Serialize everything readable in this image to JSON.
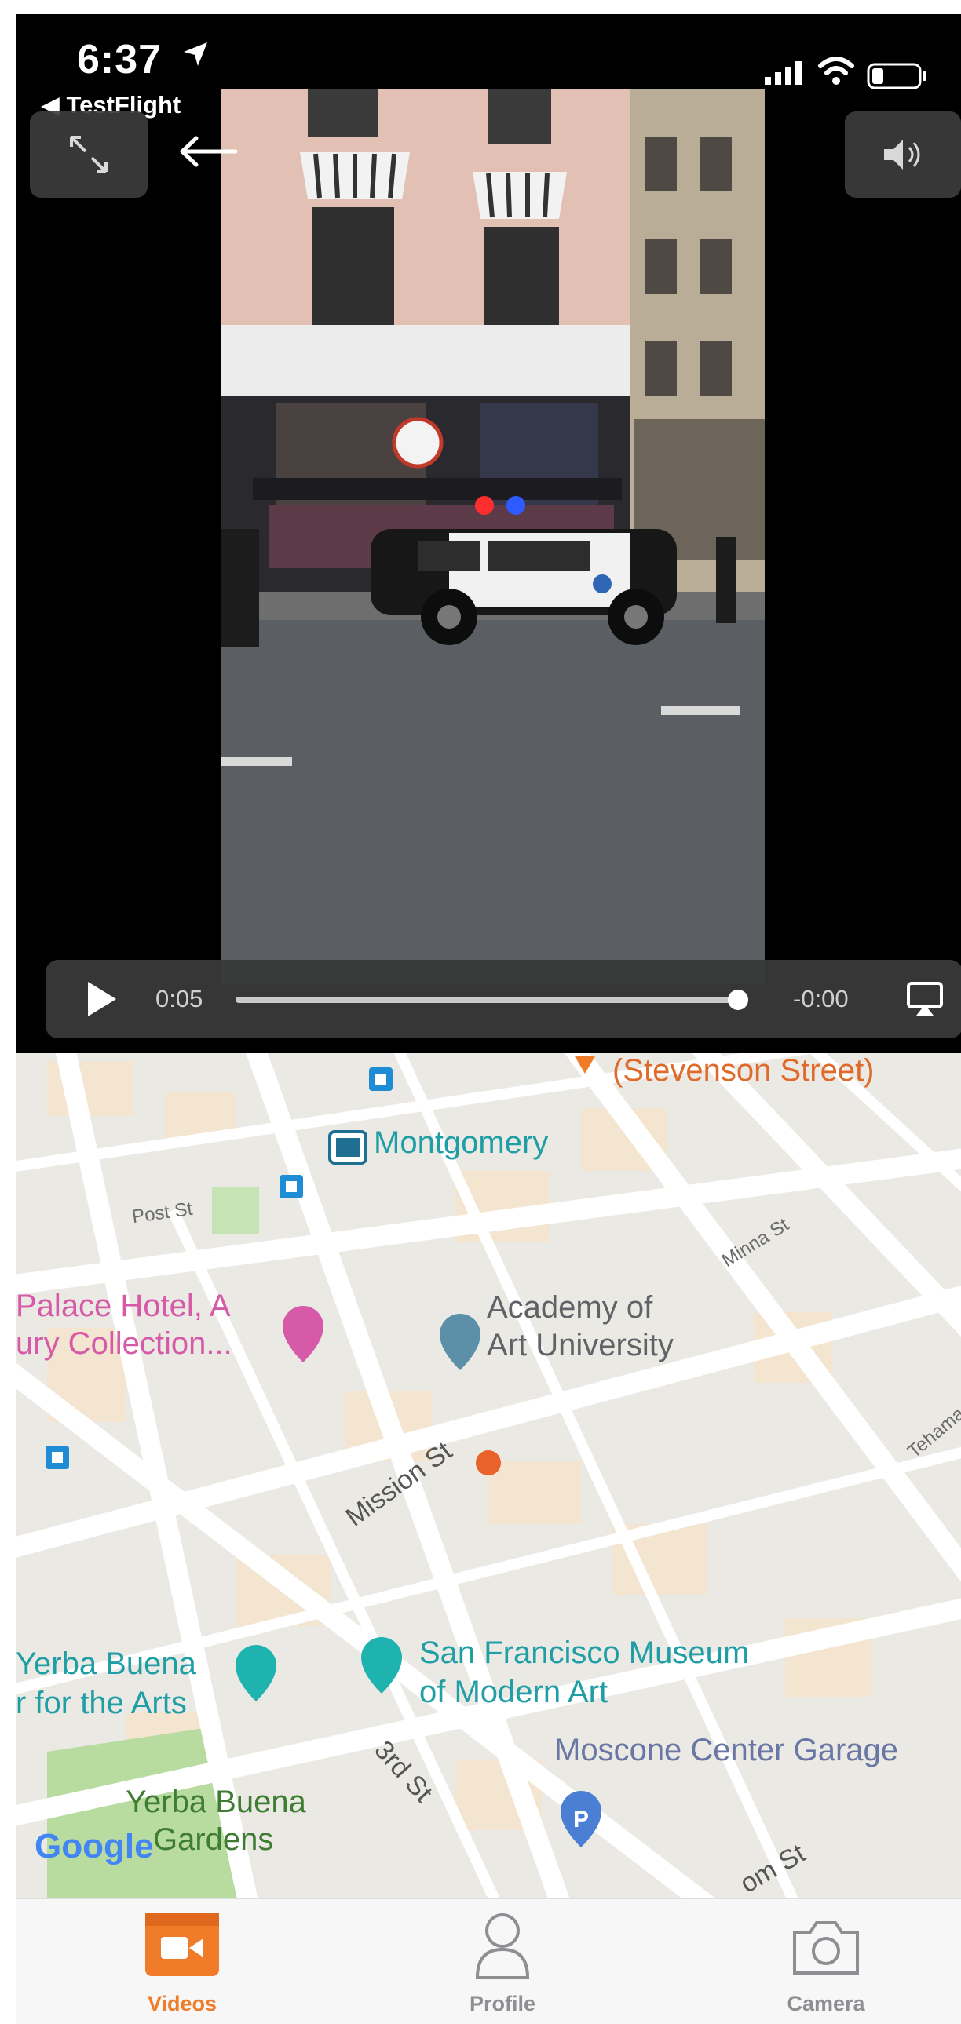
{
  "status": {
    "time": "6:37",
    "back_app": "◀ TestFlight"
  },
  "video": {
    "elapsed": "0:05",
    "remaining": "-0:00",
    "progress": 1.0
  },
  "map": {
    "labels": {
      "stevenson": "(Stevenson Street)",
      "montgomery": "Montgomery",
      "post_st": "Post St",
      "minna_st": "Minna St",
      "palace_1": "Palace Hotel, A",
      "palace_2": "ury Collection...",
      "academy_1": "Academy of",
      "academy_2": "Art University",
      "mission_st": "Mission St",
      "tehama": "Tehama",
      "yerba_arts_1": "Yerba Buena",
      "yerba_arts_2": "r for the Arts",
      "sfmoma_1": "San Francisco Museum",
      "sfmoma_2": "of Modern Art",
      "moscone": "Moscone Center Garage",
      "third_st": "3rd St",
      "yerba_gardens_1": "Yerba Buena",
      "yerba_gardens_2": "Gardens",
      "howard_partial": "om St",
      "google": "Google"
    }
  },
  "tabs": [
    {
      "label": "Videos",
      "active": true
    },
    {
      "label": "Profile",
      "active": false
    },
    {
      "label": "Camera",
      "active": false
    }
  ],
  "colors": {
    "accent": "#f07c2a",
    "teal": "#1f9ea6",
    "pink": "#d65aa8",
    "tab_inactive": "#8e8e93"
  }
}
